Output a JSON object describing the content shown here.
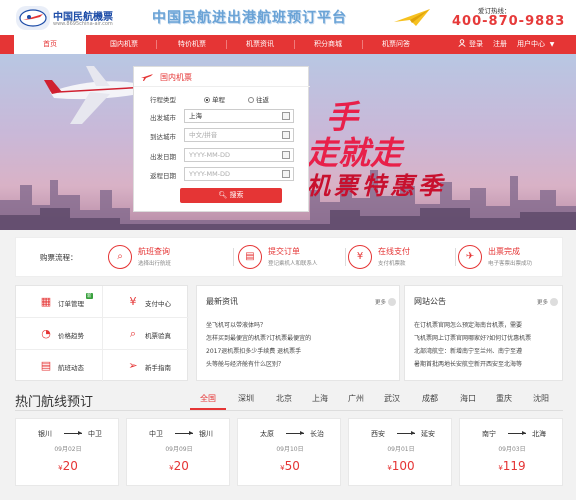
{
  "header": {
    "logo_title": "中国民航機票",
    "logo_sub": "www.8695china-air.com",
    "slogan": "中国民航进出港航班预订平台",
    "hotline_label": "爱订热线：",
    "hotline_number": "400-870-9883"
  },
  "nav": {
    "items": [
      "首页",
      "国内机票",
      "特价机票",
      "机票资讯",
      "积分商城",
      "机票问答"
    ],
    "login": "登录",
    "register": "注册",
    "user_center": "用户中心"
  },
  "banner": {
    "line1": "手",
    "line2": "走就走",
    "line3": "机票特惠季"
  },
  "search": {
    "title": "国内机票",
    "trip_type_label": "行程类型",
    "one_way": "单程",
    "round_trip": "往返",
    "from_label": "出发城市",
    "from_value": "上海",
    "to_label": "到达城市",
    "to_placeholder": "中文/拼音",
    "depart_label": "出发日期",
    "depart_placeholder": "YYYY-MM-DD",
    "return_label": "返程日期",
    "return_placeholder": "YYYY-MM-DD",
    "button": "搜索"
  },
  "process": {
    "title": "购票流程：",
    "steps": [
      {
        "title": "航班查询",
        "sub": "选择出行航班",
        "icon": "search-icon"
      },
      {
        "title": "提交订单",
        "sub": "登记乘机人和联系人",
        "icon": "document-icon"
      },
      {
        "title": "在线支付",
        "sub": "支付机票款",
        "icon": "yen-icon"
      },
      {
        "title": "出票完成",
        "sub": "电子客票出票成功",
        "icon": "ticket-icon"
      }
    ]
  },
  "quick": {
    "items": [
      "订单管理",
      "支付中心",
      "价格趋势",
      "机票验真",
      "航班动态",
      "新手指南"
    ],
    "badge": "新"
  },
  "news": {
    "title": "最新资讯",
    "more": "更多",
    "items": [
      "坐飞机可以带液体吗？",
      "怎样买到最便宜的机票?订机票最便宜的",
      "2017退机票扣多少手续费 退机票手",
      "头等舱与经济舱有什么区别？"
    ]
  },
  "notice": {
    "title": "网站公告",
    "more": "更多",
    "items": [
      "在订机票官网怎么预定海南台机票，需要",
      "飞机票网上订票官网哪家好?如何订优惠机票",
      "北部湾航空：新增南宁至兰州、南宁至遵",
      "暑期首批两地长安航空新开西安至北海等"
    ]
  },
  "hot": {
    "title": "热门航线预订",
    "tabs": [
      "全国",
      "深圳",
      "北京",
      "上海",
      "广州",
      "武汉",
      "成都",
      "海口",
      "重庆",
      "沈阳"
    ],
    "active_tab": "全国",
    "routes": [
      {
        "from": "银川",
        "to": "中卫",
        "date": "09月02日",
        "currency": "¥",
        "price": "20"
      },
      {
        "from": "中卫",
        "to": "银川",
        "date": "09月09日",
        "currency": "¥",
        "price": "20"
      },
      {
        "from": "太原",
        "to": "长治",
        "date": "09月10日",
        "currency": "¥",
        "price": "50"
      },
      {
        "from": "西安",
        "to": "延安",
        "date": "09月01日",
        "currency": "¥",
        "price": "100"
      },
      {
        "from": "南宁",
        "to": "北海",
        "date": "09月03日",
        "currency": "¥",
        "price": "119"
      }
    ]
  },
  "colors": {
    "accent": "#e53535",
    "brand_blue": "#1e4da8"
  }
}
